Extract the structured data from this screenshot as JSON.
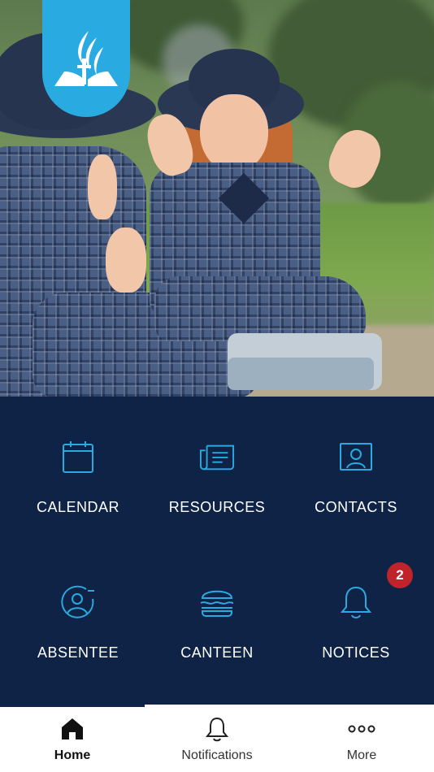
{
  "hero": {
    "image_description": "",
    "logo_name": "church-logo"
  },
  "colors": {
    "background": "#0f2346",
    "icon_accent": "#29aae1",
    "badge": "#c0242b",
    "tabbar": "#ffffff"
  },
  "menu": {
    "items": [
      {
        "label": "CALENDAR",
        "icon": "calendar-icon"
      },
      {
        "label": "RESOURCES",
        "icon": "newspaper-icon"
      },
      {
        "label": "CONTACTS",
        "icon": "contact-card-icon"
      },
      {
        "label": "ABSENTEE",
        "icon": "user-minus-icon"
      },
      {
        "label": "CANTEEN",
        "icon": "burger-icon"
      },
      {
        "label": "NOTICES",
        "icon": "bell-icon",
        "badge": "2"
      }
    ]
  },
  "tabbar": {
    "tabs": [
      {
        "label": "Home",
        "icon": "home-icon",
        "active": true
      },
      {
        "label": "Notifications",
        "icon": "bell-outline-icon",
        "active": false
      },
      {
        "label": "More",
        "icon": "more-dots-icon",
        "active": false
      }
    ]
  }
}
